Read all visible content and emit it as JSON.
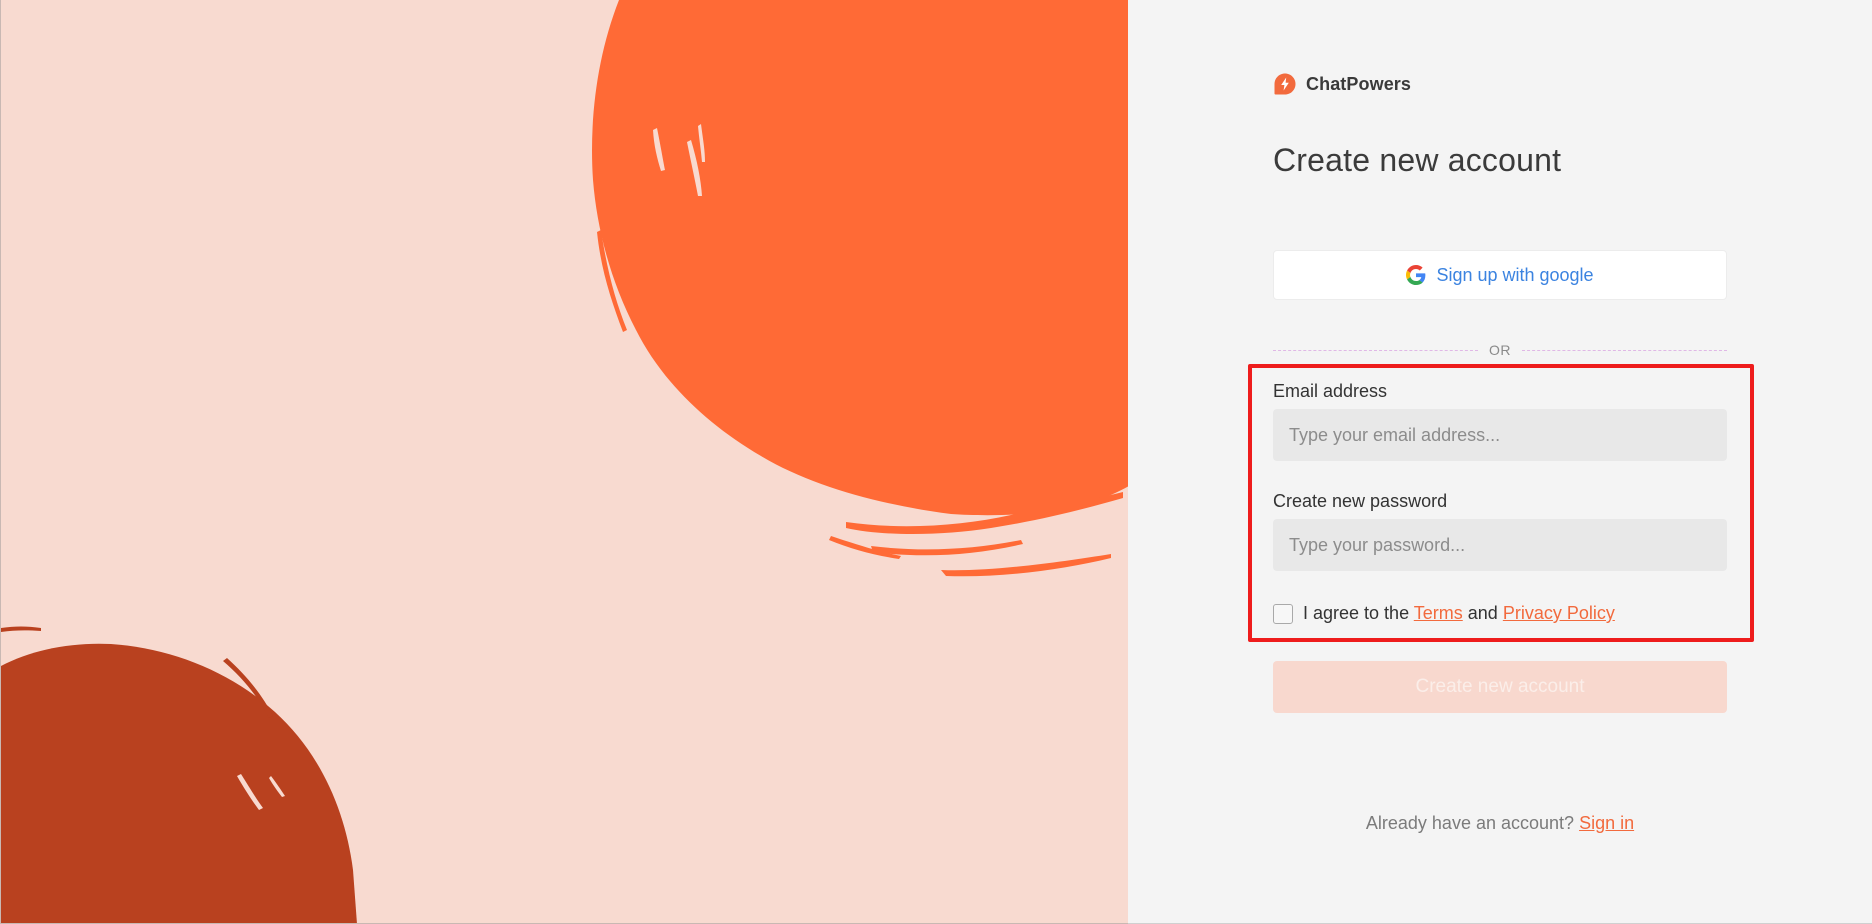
{
  "brand": {
    "name": "ChatPowers",
    "logo_icon": "lightning-bolt-icon",
    "accent_color": "#f26a3d"
  },
  "art": {
    "background_color": "#f8dad0",
    "large_circle_color": "#ff6a36",
    "small_circle_color": "#b9411f"
  },
  "form": {
    "title": "Create new account",
    "google_button_label": "Sign up with google",
    "divider_text": "OR",
    "email": {
      "label": "Email address",
      "placeholder": "Type your email address...",
      "value": ""
    },
    "password": {
      "label": "Create new password",
      "placeholder": "Type your password...",
      "value": ""
    },
    "agree": {
      "prefix": "I agree to the",
      "terms_link": "Terms",
      "conjunction": "and",
      "privacy_link": "Privacy Policy",
      "checked": false
    },
    "submit_label": "Create new account",
    "signin_prompt": "Already have an account?",
    "signin_link": "Sign in"
  },
  "highlight": {
    "color": "#ee1c1c",
    "target": "email-password-agree-section"
  }
}
